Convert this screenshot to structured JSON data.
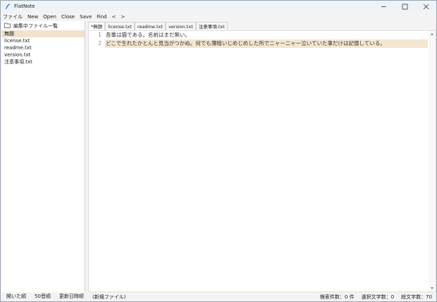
{
  "window": {
    "title": "FlatNote"
  },
  "menu": [
    "ファイル",
    "New",
    "Open",
    "Close",
    "Save",
    "Find",
    "<",
    ">"
  ],
  "sidebar": {
    "header": "編集中ファイル一覧",
    "files": [
      "無題",
      "license.txt",
      "readme.txt",
      "version.txt",
      "注意事項.txt"
    ],
    "selected_index": 0,
    "sort_options": [
      "開いた順",
      "50音順",
      "更新日時順"
    ]
  },
  "tabs": [
    "*無題",
    "license.txt",
    "readme.txt",
    "version.txt",
    "注意事項.txt"
  ],
  "active_tab_index": 0,
  "editor": {
    "lines": [
      {
        "number": "1",
        "text": "吾輩は猫である。名前はまだ無い。"
      },
      {
        "number": "2",
        "text": "どこで生れたかとんと見当がつかぬ。何でも薄暗いじめじめした所でニャーニャー泣いていた事だけは記憶している。"
      }
    ],
    "current_line_index": 1
  },
  "status": {
    "file": "(新規ファイル)",
    "search_count": "検索件数：0 件",
    "selected_chars": "選択文字数：0",
    "total_chars": "総文字数：70"
  },
  "colors": {
    "selection": "#f0e2cc",
    "current_line": "#f4e6d0",
    "accent": "#2b6cd4"
  }
}
